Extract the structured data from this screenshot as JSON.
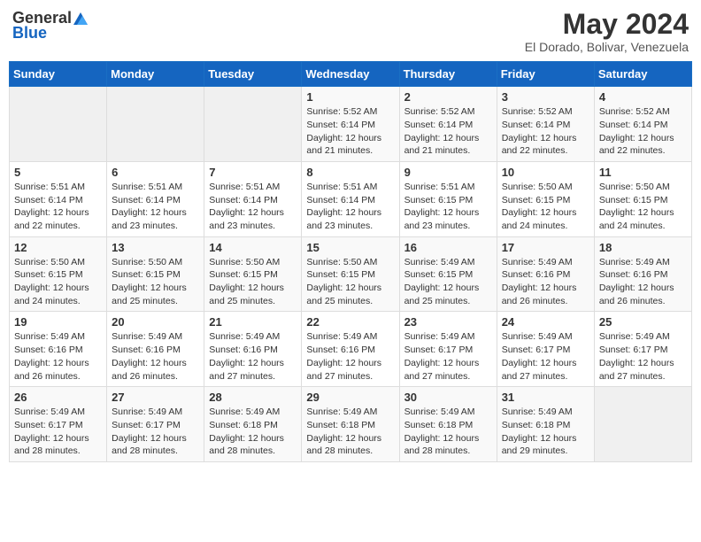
{
  "header": {
    "logo": {
      "general": "General",
      "blue": "Blue"
    },
    "title": "May 2024",
    "location": "El Dorado, Bolivar, Venezuela"
  },
  "weekdays": [
    "Sunday",
    "Monday",
    "Tuesday",
    "Wednesday",
    "Thursday",
    "Friday",
    "Saturday"
  ],
  "weeks": [
    [
      {
        "day": "",
        "info": ""
      },
      {
        "day": "",
        "info": ""
      },
      {
        "day": "",
        "info": ""
      },
      {
        "day": "1",
        "info": "Sunrise: 5:52 AM\nSunset: 6:14 PM\nDaylight: 12 hours\nand 21 minutes."
      },
      {
        "day": "2",
        "info": "Sunrise: 5:52 AM\nSunset: 6:14 PM\nDaylight: 12 hours\nand 21 minutes."
      },
      {
        "day": "3",
        "info": "Sunrise: 5:52 AM\nSunset: 6:14 PM\nDaylight: 12 hours\nand 22 minutes."
      },
      {
        "day": "4",
        "info": "Sunrise: 5:52 AM\nSunset: 6:14 PM\nDaylight: 12 hours\nand 22 minutes."
      }
    ],
    [
      {
        "day": "5",
        "info": "Sunrise: 5:51 AM\nSunset: 6:14 PM\nDaylight: 12 hours\nand 22 minutes."
      },
      {
        "day": "6",
        "info": "Sunrise: 5:51 AM\nSunset: 6:14 PM\nDaylight: 12 hours\nand 23 minutes."
      },
      {
        "day": "7",
        "info": "Sunrise: 5:51 AM\nSunset: 6:14 PM\nDaylight: 12 hours\nand 23 minutes."
      },
      {
        "day": "8",
        "info": "Sunrise: 5:51 AM\nSunset: 6:14 PM\nDaylight: 12 hours\nand 23 minutes."
      },
      {
        "day": "9",
        "info": "Sunrise: 5:51 AM\nSunset: 6:15 PM\nDaylight: 12 hours\nand 23 minutes."
      },
      {
        "day": "10",
        "info": "Sunrise: 5:50 AM\nSunset: 6:15 PM\nDaylight: 12 hours\nand 24 minutes."
      },
      {
        "day": "11",
        "info": "Sunrise: 5:50 AM\nSunset: 6:15 PM\nDaylight: 12 hours\nand 24 minutes."
      }
    ],
    [
      {
        "day": "12",
        "info": "Sunrise: 5:50 AM\nSunset: 6:15 PM\nDaylight: 12 hours\nand 24 minutes."
      },
      {
        "day": "13",
        "info": "Sunrise: 5:50 AM\nSunset: 6:15 PM\nDaylight: 12 hours\nand 25 minutes."
      },
      {
        "day": "14",
        "info": "Sunrise: 5:50 AM\nSunset: 6:15 PM\nDaylight: 12 hours\nand 25 minutes."
      },
      {
        "day": "15",
        "info": "Sunrise: 5:50 AM\nSunset: 6:15 PM\nDaylight: 12 hours\nand 25 minutes."
      },
      {
        "day": "16",
        "info": "Sunrise: 5:49 AM\nSunset: 6:15 PM\nDaylight: 12 hours\nand 25 minutes."
      },
      {
        "day": "17",
        "info": "Sunrise: 5:49 AM\nSunset: 6:16 PM\nDaylight: 12 hours\nand 26 minutes."
      },
      {
        "day": "18",
        "info": "Sunrise: 5:49 AM\nSunset: 6:16 PM\nDaylight: 12 hours\nand 26 minutes."
      }
    ],
    [
      {
        "day": "19",
        "info": "Sunrise: 5:49 AM\nSunset: 6:16 PM\nDaylight: 12 hours\nand 26 minutes."
      },
      {
        "day": "20",
        "info": "Sunrise: 5:49 AM\nSunset: 6:16 PM\nDaylight: 12 hours\nand 26 minutes."
      },
      {
        "day": "21",
        "info": "Sunrise: 5:49 AM\nSunset: 6:16 PM\nDaylight: 12 hours\nand 27 minutes."
      },
      {
        "day": "22",
        "info": "Sunrise: 5:49 AM\nSunset: 6:16 PM\nDaylight: 12 hours\nand 27 minutes."
      },
      {
        "day": "23",
        "info": "Sunrise: 5:49 AM\nSunset: 6:17 PM\nDaylight: 12 hours\nand 27 minutes."
      },
      {
        "day": "24",
        "info": "Sunrise: 5:49 AM\nSunset: 6:17 PM\nDaylight: 12 hours\nand 27 minutes."
      },
      {
        "day": "25",
        "info": "Sunrise: 5:49 AM\nSunset: 6:17 PM\nDaylight: 12 hours\nand 27 minutes."
      }
    ],
    [
      {
        "day": "26",
        "info": "Sunrise: 5:49 AM\nSunset: 6:17 PM\nDaylight: 12 hours\nand 28 minutes."
      },
      {
        "day": "27",
        "info": "Sunrise: 5:49 AM\nSunset: 6:17 PM\nDaylight: 12 hours\nand 28 minutes."
      },
      {
        "day": "28",
        "info": "Sunrise: 5:49 AM\nSunset: 6:18 PM\nDaylight: 12 hours\nand 28 minutes."
      },
      {
        "day": "29",
        "info": "Sunrise: 5:49 AM\nSunset: 6:18 PM\nDaylight: 12 hours\nand 28 minutes."
      },
      {
        "day": "30",
        "info": "Sunrise: 5:49 AM\nSunset: 6:18 PM\nDaylight: 12 hours\nand 28 minutes."
      },
      {
        "day": "31",
        "info": "Sunrise: 5:49 AM\nSunset: 6:18 PM\nDaylight: 12 hours\nand 29 minutes."
      },
      {
        "day": "",
        "info": ""
      }
    ]
  ]
}
